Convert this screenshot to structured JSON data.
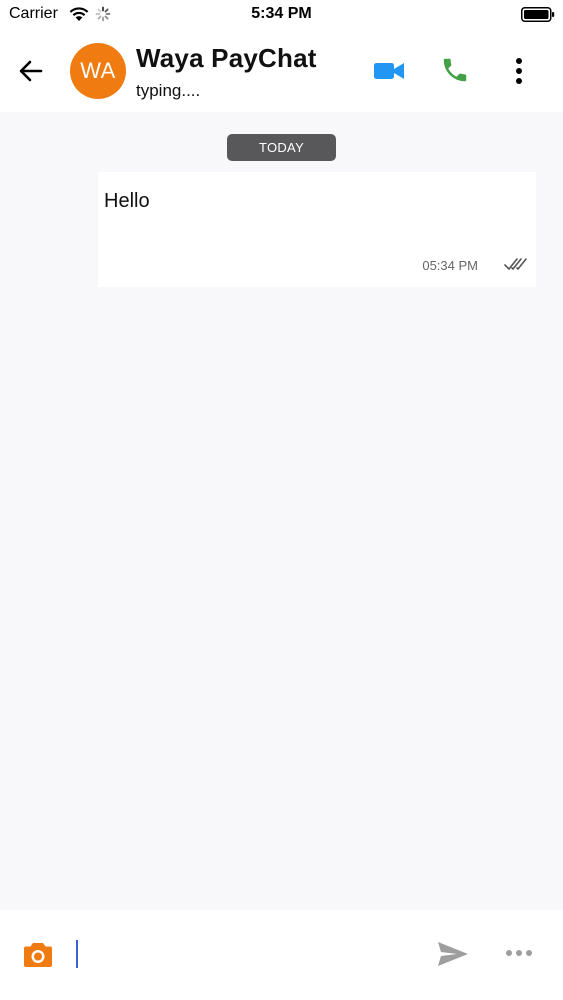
{
  "status_bar": {
    "carrier": "Carrier",
    "time": "5:34 PM"
  },
  "header": {
    "avatar_initials": "WA",
    "contact_name": "Waya PayChat",
    "contact_status": "typing....",
    "icons": {
      "back": "arrow-left-icon",
      "video": "video-camera-icon",
      "voice": "phone-icon",
      "menu": "more-vertical-icon"
    }
  },
  "chat": {
    "date_separator": "TODAY",
    "messages": [
      {
        "text": "Hello",
        "time": "05:34 PM",
        "status": "read"
      }
    ]
  },
  "composer": {
    "value": "",
    "icons": {
      "camera": "camera-icon",
      "send": "send-icon",
      "more": "more-horizontal-icon"
    }
  },
  "colors": {
    "avatar": "#f07b10",
    "video_icon": "#2196f3",
    "phone_icon": "#43a047",
    "camera_icon": "#f07b10",
    "date_chip": "#58585a",
    "chat_background": "#f8f7fa",
    "cursor": "#3b5fd0"
  }
}
